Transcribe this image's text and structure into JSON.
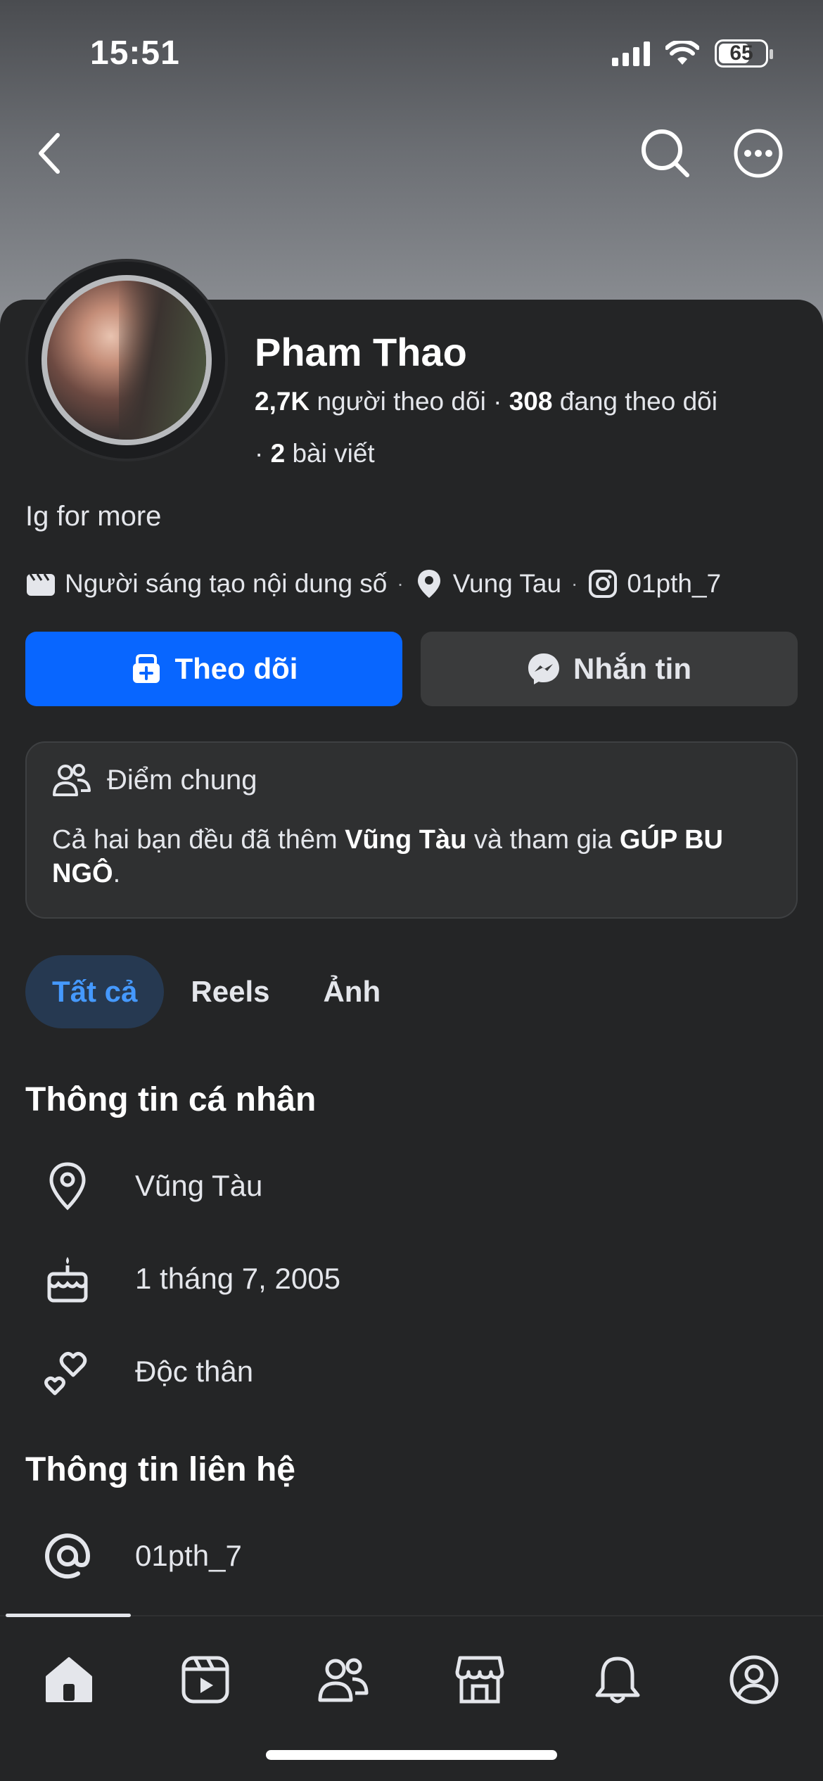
{
  "status_bar": {
    "time": "15:51",
    "battery": "65"
  },
  "profile": {
    "name": "Pham Thao",
    "followers_count": "2,7K",
    "followers_label": "người theo dõi",
    "following_count": "308",
    "following_label": "đang theo dõi",
    "posts_count": "2",
    "posts_label": "bài viết",
    "bio": "Ig for more"
  },
  "details": {
    "category": "Người sáng tạo nội dung số",
    "location": "Vung Tau",
    "instagram": "01pth_7"
  },
  "actions": {
    "follow_label": "Theo dõi",
    "message_label": "Nhắn tin"
  },
  "mutual": {
    "title": "Điểm chung",
    "text_prefix": "Cả hai bạn đều đã thêm ",
    "place": "Vũng Tàu",
    "text_mid": " và tham gia ",
    "group": "GÚP BU NGÔ",
    "text_suffix": "."
  },
  "tabs": [
    {
      "label": "Tất cả",
      "active": true
    },
    {
      "label": "Reels",
      "active": false
    },
    {
      "label": "Ảnh",
      "active": false
    }
  ],
  "personal_info": {
    "title": "Thông tin cá nhân",
    "location": "Vũng Tàu",
    "birthday": "1 tháng 7, 2005",
    "relationship": "Độc thân"
  },
  "contact_info": {
    "title": "Thông tin liên hệ",
    "username": "01pth_7"
  },
  "colors": {
    "primary": "#0866ff",
    "background": "#242526",
    "active_tab_bg": "#263951",
    "active_tab_text": "#4599ff"
  },
  "bottom_nav": [
    "home-icon",
    "video-icon",
    "friends-icon",
    "marketplace-icon",
    "bell-icon",
    "profile-icon"
  ]
}
